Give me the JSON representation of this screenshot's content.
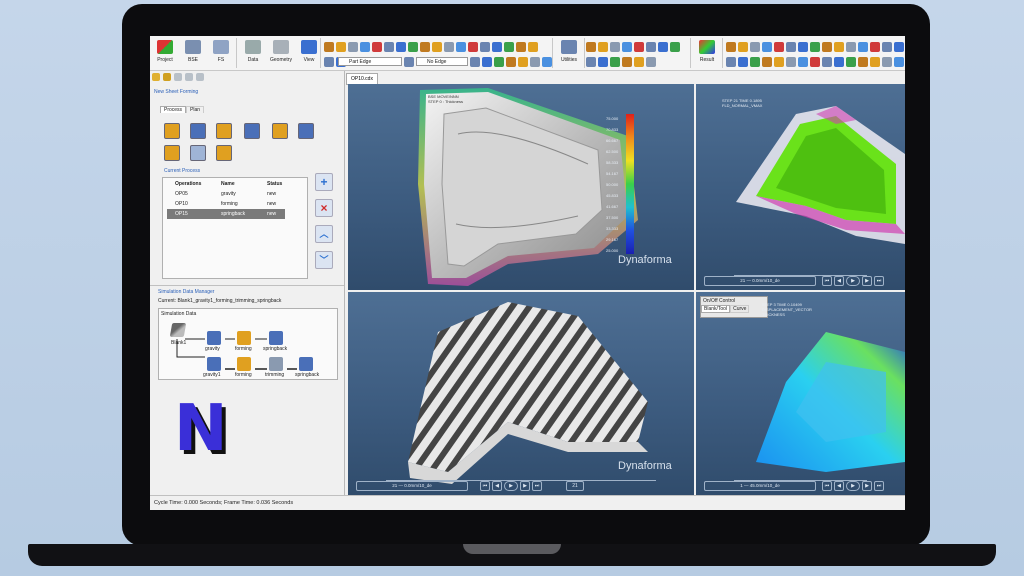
{
  "ribbon": {
    "project": "Project",
    "bse": "BSE",
    "fs": "FS",
    "data": "Data",
    "geometry": "Geometry",
    "view": "View",
    "part_filter": "Part Edge",
    "edge_filter": "No Edge",
    "utilities": "Utilities",
    "result": "Result"
  },
  "left_panel": {
    "title": "New Sheet Forming",
    "tabs": [
      "Process",
      "Plan"
    ],
    "current_process_label": "Current Process",
    "columns": [
      "Operations",
      "Name",
      "Status"
    ],
    "rows": [
      {
        "op": "OP05",
        "name": "gravity",
        "status": "new"
      },
      {
        "op": "OP10",
        "name": "forming",
        "status": "new"
      },
      {
        "op": "OP15",
        "name": "springback",
        "status": "new"
      }
    ],
    "sdm_title": "Simulation Data Manager",
    "sdm_current": "Current: Blank1_gravity1_forming_trimming_springback",
    "sim_data_label": "Simulation Data",
    "nodes": {
      "blank": "Blank1",
      "gravity": "gravity",
      "forming_top": "forming",
      "springback_top": "springback",
      "gravity1": "gravity1",
      "forming": "forming",
      "trimming": "trimming",
      "springback": "springback"
    },
    "logo_letter": "N"
  },
  "doc_tab": "OP10.cdx",
  "viewports": {
    "brand": "Dynaforma",
    "tl": {
      "info": [
        "BSE MOVE/NNN",
        "STEP 0 : Thickness"
      ],
      "legend": [
        "75.000",
        "70.833",
        "66.667",
        "62.500",
        "58.333",
        "54.167",
        "50.000",
        "45.833",
        "41.667",
        "37.500",
        "33.333",
        "29.167",
        "25.000"
      ]
    },
    "tr": {
      "info": [
        "STEP 21  TIME 0.1895",
        "FLD_NORMAL_VMAX"
      ],
      "field": "21 — 0.0mm/10_de"
    },
    "bl": {
      "field": "21 — 0.0mm/10_de",
      "frame": "21"
    },
    "br": {
      "panel_title": "On/Off Control",
      "tabs": [
        "Blank/Tool",
        "Curve"
      ],
      "info": [
        "STEP 3  TIME 0.10499",
        "DISPLACEMENT_VECTOR",
        "THICKNESS"
      ],
      "field": "1 — 45.0mm/10_de"
    }
  },
  "colors": {
    "accent_blue": "#2a5fb8",
    "logo_blue": "#3a2fd8",
    "viewport_bg": "#3d5c80"
  },
  "status_bar": "Cycle Time: 0.000 Seconds; Frame Time: 0.036 Seconds"
}
